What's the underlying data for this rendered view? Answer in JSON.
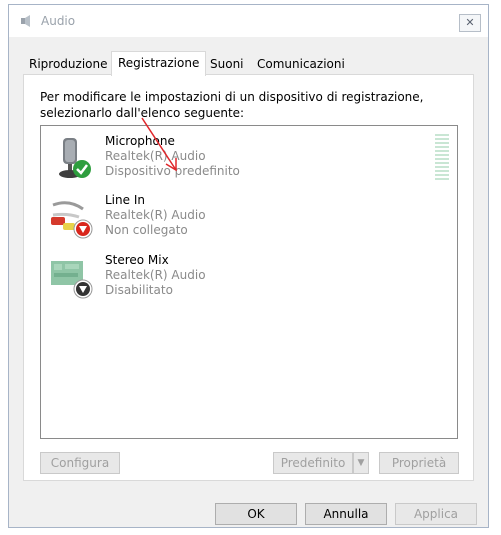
{
  "window": {
    "title": "Audio",
    "close_label": "✕"
  },
  "tabs": [
    {
      "label": "Riproduzione",
      "active": false
    },
    {
      "label": "Registrazione",
      "active": true
    },
    {
      "label": "Suoni",
      "active": false
    },
    {
      "label": "Comunicazioni",
      "active": false
    }
  ],
  "instructions": "Per modificare le impostazioni di un dispositivo di registrazione, selezionarlo dall'elenco seguente:",
  "devices": [
    {
      "name": "Microphone",
      "driver": "Realtek(R) Audio",
      "status": "Dispositivo predefinito",
      "icon": "microphone-icon",
      "badge": "default-check-icon",
      "badge_color": "#2e9e3e"
    },
    {
      "name": "Line In",
      "driver": "Realtek(R) Audio",
      "status": "Non collegato",
      "icon": "line-in-cable-icon",
      "badge": "unplugged-icon",
      "badge_color": "#d9261c"
    },
    {
      "name": "Stereo Mix",
      "driver": "Realtek(R) Audio",
      "status": "Disabilitato",
      "icon": "sound-card-icon",
      "badge": "disabled-icon",
      "badge_color": "#333333"
    }
  ],
  "buttons": {
    "configure": "Configura",
    "set_default": "Predefinito",
    "properties": "Proprietà",
    "ok": "OK",
    "cancel": "Annulla",
    "apply": "Applica"
  },
  "colors": {
    "level_meter": "#c9e6d4",
    "annotation_arrow": "#e0262a"
  }
}
